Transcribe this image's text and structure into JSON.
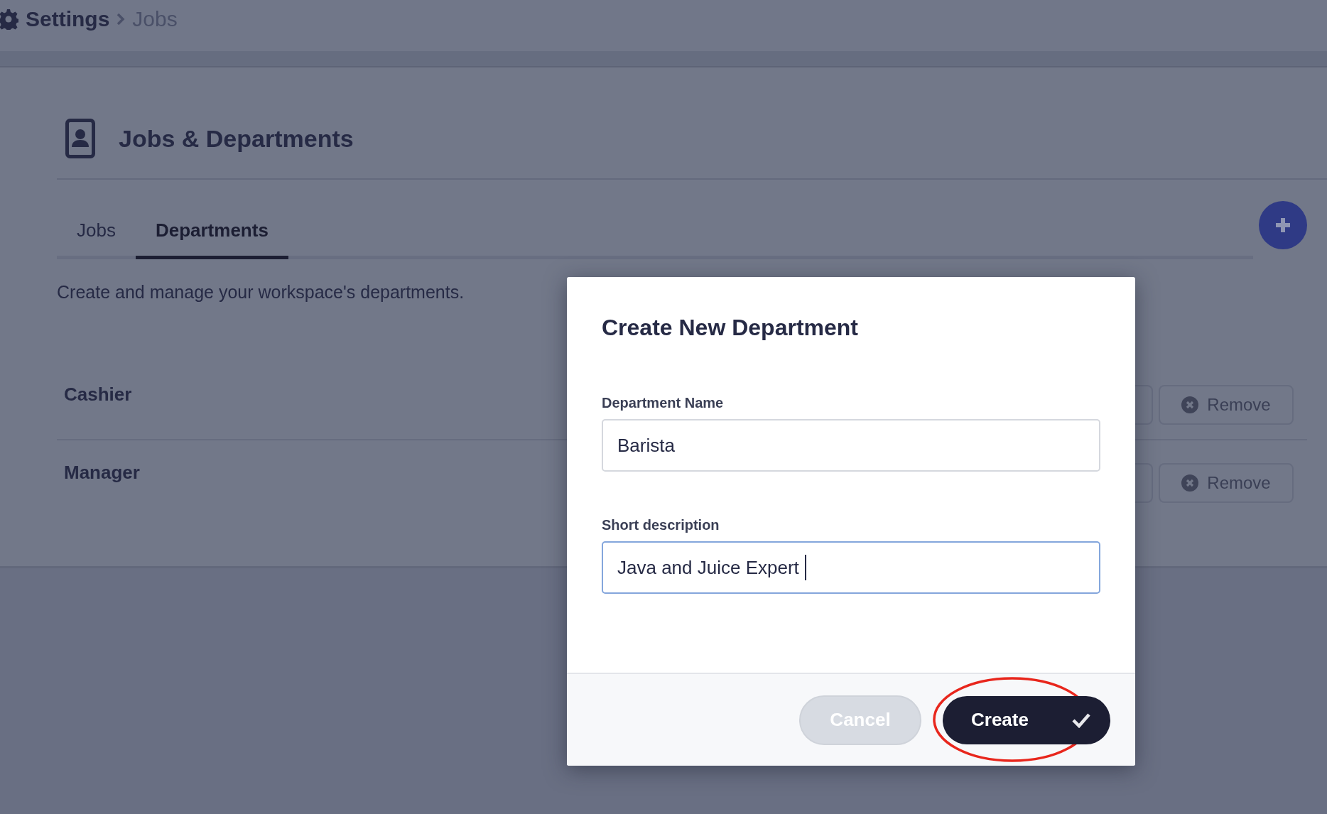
{
  "breadcrumb": {
    "items": [
      {
        "label": "Settings",
        "current": false
      },
      {
        "label": "Jobs",
        "current": true
      }
    ]
  },
  "page": {
    "title": "Jobs & Departments",
    "tabs": [
      {
        "label": "Jobs",
        "selected": false
      },
      {
        "label": "Departments",
        "selected": true
      }
    ],
    "description": "Create and manage your workspace's departments.",
    "departments": [
      {
        "name": "Cashier",
        "action": "Remove"
      },
      {
        "name": "Manager",
        "action": "Remove"
      }
    ]
  },
  "modal": {
    "title": "Create New Department",
    "fields": [
      {
        "label": "Department Name",
        "value": "Barista",
        "focused": false
      },
      {
        "label": "Short description",
        "value": "Java and Juice Expert",
        "focused": true
      }
    ],
    "buttons": [
      {
        "label": "Cancel",
        "kind": "secondary",
        "circled": false
      },
      {
        "label": "Create",
        "kind": "primary",
        "circled": true
      }
    ]
  }
}
